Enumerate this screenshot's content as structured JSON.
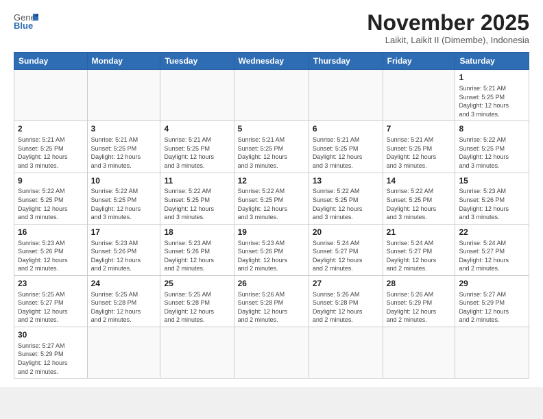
{
  "logo": {
    "text_general": "General",
    "text_blue": "Blue"
  },
  "header": {
    "month_year": "November 2025",
    "subtitle": "Laikit, Laikit II (Dimembe), Indonesia"
  },
  "columns": [
    "Sunday",
    "Monday",
    "Tuesday",
    "Wednesday",
    "Thursday",
    "Friday",
    "Saturday"
  ],
  "weeks": [
    [
      {
        "day": "",
        "info": ""
      },
      {
        "day": "",
        "info": ""
      },
      {
        "day": "",
        "info": ""
      },
      {
        "day": "",
        "info": ""
      },
      {
        "day": "",
        "info": ""
      },
      {
        "day": "",
        "info": ""
      },
      {
        "day": "1",
        "info": "Sunrise: 5:21 AM\nSunset: 5:25 PM\nDaylight: 12 hours\nand 3 minutes."
      }
    ],
    [
      {
        "day": "2",
        "info": "Sunrise: 5:21 AM\nSunset: 5:25 PM\nDaylight: 12 hours\nand 3 minutes."
      },
      {
        "day": "3",
        "info": "Sunrise: 5:21 AM\nSunset: 5:25 PM\nDaylight: 12 hours\nand 3 minutes."
      },
      {
        "day": "4",
        "info": "Sunrise: 5:21 AM\nSunset: 5:25 PM\nDaylight: 12 hours\nand 3 minutes."
      },
      {
        "day": "5",
        "info": "Sunrise: 5:21 AM\nSunset: 5:25 PM\nDaylight: 12 hours\nand 3 minutes."
      },
      {
        "day": "6",
        "info": "Sunrise: 5:21 AM\nSunset: 5:25 PM\nDaylight: 12 hours\nand 3 minutes."
      },
      {
        "day": "7",
        "info": "Sunrise: 5:21 AM\nSunset: 5:25 PM\nDaylight: 12 hours\nand 3 minutes."
      },
      {
        "day": "8",
        "info": "Sunrise: 5:22 AM\nSunset: 5:25 PM\nDaylight: 12 hours\nand 3 minutes."
      }
    ],
    [
      {
        "day": "9",
        "info": "Sunrise: 5:22 AM\nSunset: 5:25 PM\nDaylight: 12 hours\nand 3 minutes."
      },
      {
        "day": "10",
        "info": "Sunrise: 5:22 AM\nSunset: 5:25 PM\nDaylight: 12 hours\nand 3 minutes."
      },
      {
        "day": "11",
        "info": "Sunrise: 5:22 AM\nSunset: 5:25 PM\nDaylight: 12 hours\nand 3 minutes."
      },
      {
        "day": "12",
        "info": "Sunrise: 5:22 AM\nSunset: 5:25 PM\nDaylight: 12 hours\nand 3 minutes."
      },
      {
        "day": "13",
        "info": "Sunrise: 5:22 AM\nSunset: 5:25 PM\nDaylight: 12 hours\nand 3 minutes."
      },
      {
        "day": "14",
        "info": "Sunrise: 5:22 AM\nSunset: 5:25 PM\nDaylight: 12 hours\nand 3 minutes."
      },
      {
        "day": "15",
        "info": "Sunrise: 5:23 AM\nSunset: 5:26 PM\nDaylight: 12 hours\nand 3 minutes."
      }
    ],
    [
      {
        "day": "16",
        "info": "Sunrise: 5:23 AM\nSunset: 5:26 PM\nDaylight: 12 hours\nand 2 minutes."
      },
      {
        "day": "17",
        "info": "Sunrise: 5:23 AM\nSunset: 5:26 PM\nDaylight: 12 hours\nand 2 minutes."
      },
      {
        "day": "18",
        "info": "Sunrise: 5:23 AM\nSunset: 5:26 PM\nDaylight: 12 hours\nand 2 minutes."
      },
      {
        "day": "19",
        "info": "Sunrise: 5:23 AM\nSunset: 5:26 PM\nDaylight: 12 hours\nand 2 minutes."
      },
      {
        "day": "20",
        "info": "Sunrise: 5:24 AM\nSunset: 5:27 PM\nDaylight: 12 hours\nand 2 minutes."
      },
      {
        "day": "21",
        "info": "Sunrise: 5:24 AM\nSunset: 5:27 PM\nDaylight: 12 hours\nand 2 minutes."
      },
      {
        "day": "22",
        "info": "Sunrise: 5:24 AM\nSunset: 5:27 PM\nDaylight: 12 hours\nand 2 minutes."
      }
    ],
    [
      {
        "day": "23",
        "info": "Sunrise: 5:25 AM\nSunset: 5:27 PM\nDaylight: 12 hours\nand 2 minutes."
      },
      {
        "day": "24",
        "info": "Sunrise: 5:25 AM\nSunset: 5:28 PM\nDaylight: 12 hours\nand 2 minutes."
      },
      {
        "day": "25",
        "info": "Sunrise: 5:25 AM\nSunset: 5:28 PM\nDaylight: 12 hours\nand 2 minutes."
      },
      {
        "day": "26",
        "info": "Sunrise: 5:26 AM\nSunset: 5:28 PM\nDaylight: 12 hours\nand 2 minutes."
      },
      {
        "day": "27",
        "info": "Sunrise: 5:26 AM\nSunset: 5:28 PM\nDaylight: 12 hours\nand 2 minutes."
      },
      {
        "day": "28",
        "info": "Sunrise: 5:26 AM\nSunset: 5:29 PM\nDaylight: 12 hours\nand 2 minutes."
      },
      {
        "day": "29",
        "info": "Sunrise: 5:27 AM\nSunset: 5:29 PM\nDaylight: 12 hours\nand 2 minutes."
      }
    ],
    [
      {
        "day": "30",
        "info": "Sunrise: 5:27 AM\nSunset: 5:29 PM\nDaylight: 12 hours\nand 2 minutes."
      },
      {
        "day": "",
        "info": ""
      },
      {
        "day": "",
        "info": ""
      },
      {
        "day": "",
        "info": ""
      },
      {
        "day": "",
        "info": ""
      },
      {
        "day": "",
        "info": ""
      },
      {
        "day": "",
        "info": ""
      }
    ]
  ]
}
